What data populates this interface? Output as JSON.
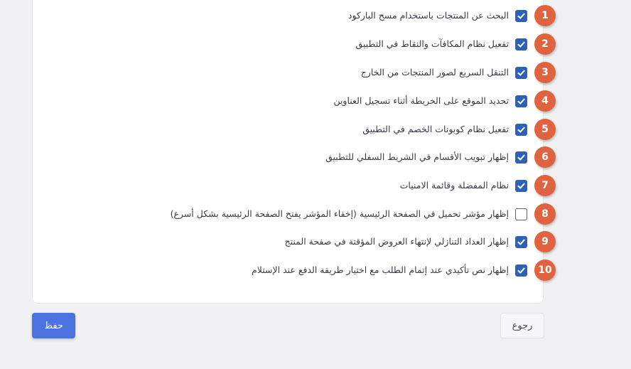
{
  "settings": {
    "items": [
      {
        "number": "1",
        "label": "البحث عن المنتجات باستخدام مسح الباركود",
        "checked": true
      },
      {
        "number": "2",
        "label": "تفعيل نظام المكافآت والنقاط في التطبيق",
        "checked": true
      },
      {
        "number": "3",
        "label": "التنقل السريع لصور المنتجات من الخارج",
        "checked": true
      },
      {
        "number": "4",
        "label": "تحديد الموقع على الخريطة أثناء تسجيل العناوين",
        "checked": true
      },
      {
        "number": "5",
        "label": "تفعيل نظام كوبونات الخصم في التطبيق",
        "checked": true
      },
      {
        "number": "6",
        "label": "إظهار تبويب الأقسام في الشريط السفلي للتطبيق",
        "checked": true
      },
      {
        "number": "7",
        "label": "نظام المفضلة وقائمة الامنيات",
        "checked": true
      },
      {
        "number": "8",
        "label": "إظهار مؤشر تحميل في الصفحة الرئيسية (إخفاء المؤشر يفتح الصفحة الرئيسية بشكل أسرع)",
        "checked": false
      },
      {
        "number": "9",
        "label": "إظهار العداد التنازلي لإنتهاء العروض المؤقتة في صفحة المنتج",
        "checked": true
      },
      {
        "number": "10",
        "label": "إظهار نص تأكيدي عند إتمام الطلب مع اختيار طريقة الدفع عند الإستلام",
        "checked": true
      }
    ]
  },
  "actions": {
    "save_label": "حفظ",
    "back_label": "رجوع"
  },
  "colors": {
    "checkbox_checked": "#2f62b4",
    "badge": "#e0633f",
    "save_button": "#4a73e0",
    "background": "#f1f1f3"
  }
}
